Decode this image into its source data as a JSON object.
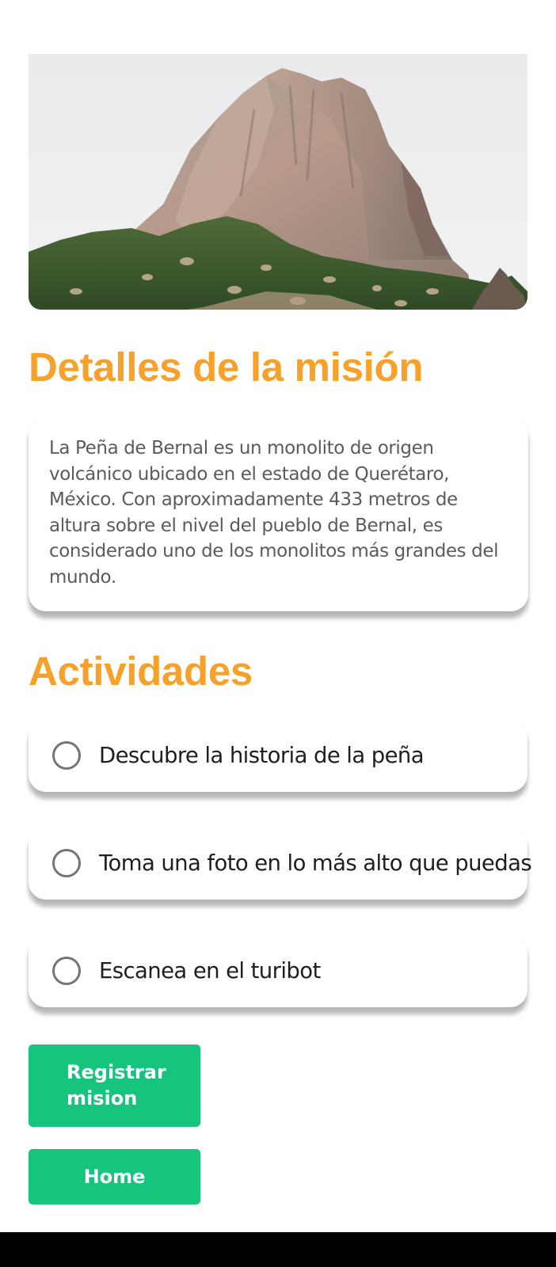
{
  "hero": {
    "alt": "Peña de Bernal"
  },
  "details": {
    "title": "Detalles de la misión",
    "description": "La Peña de Bernal es un monolito de origen volcánico ubicado en el estado de Querétaro, México. Con aproximadamente 433 metros de altura sobre el nivel del pueblo de Bernal, es considerado uno de los monolitos más grandes del mundo."
  },
  "activities": {
    "title": "Actividades",
    "items": [
      {
        "label": "Descubre la historia de la peña",
        "checked": false
      },
      {
        "label": "Toma una foto en lo más alto que puedas",
        "checked": false
      },
      {
        "label": "Escanea en el turibot",
        "checked": false
      }
    ]
  },
  "buttons": {
    "register_line1": "Registrar",
    "register_line2": "mision",
    "home": "Home"
  },
  "colors": {
    "heading": "#F7A02A",
    "button": "#17C47E",
    "radio_border": "#757575"
  }
}
